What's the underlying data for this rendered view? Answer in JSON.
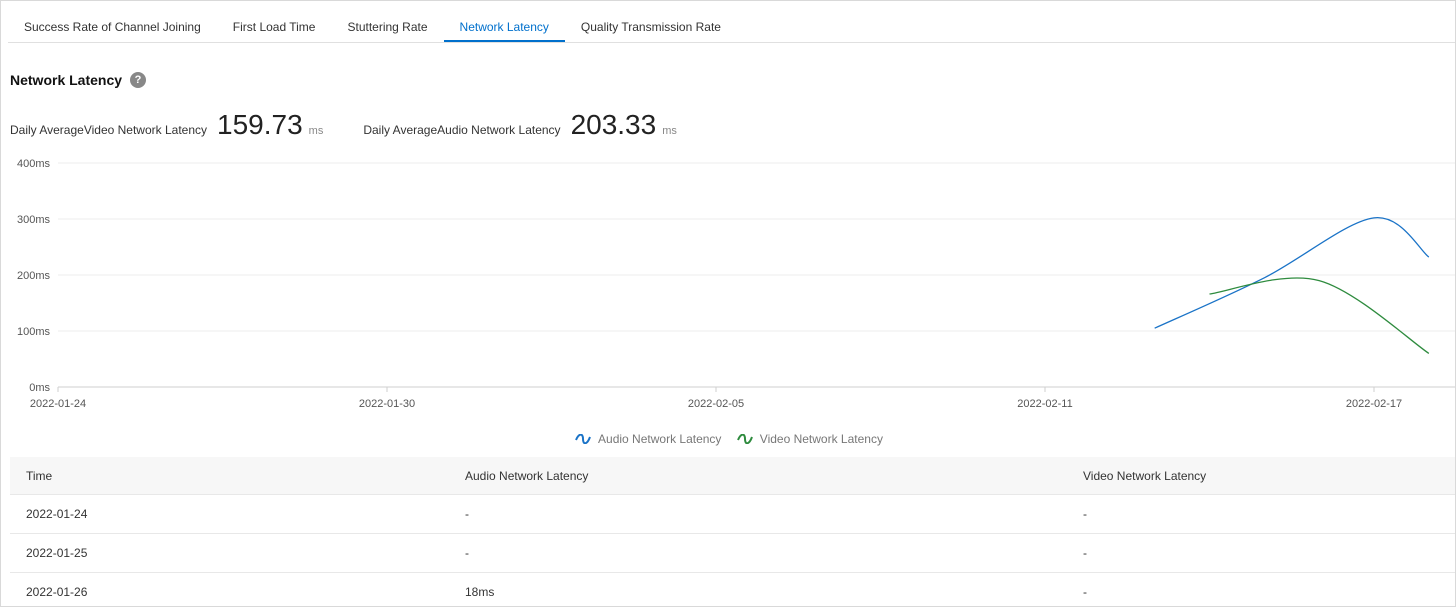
{
  "tabs": [
    {
      "label": "Success Rate of Channel Joining",
      "active": false
    },
    {
      "label": "First Load Time",
      "active": false
    },
    {
      "label": "Stuttering Rate",
      "active": false
    },
    {
      "label": "Network Latency",
      "active": true
    },
    {
      "label": "Quality Transmission Rate",
      "active": false
    }
  ],
  "section": {
    "title": "Network Latency",
    "help_icon": "question-circle-icon"
  },
  "kpis": [
    {
      "label": "Daily AverageVideo Network Latency",
      "value": "159.73",
      "unit": "ms"
    },
    {
      "label": "Daily AverageAudio Network Latency",
      "value": "203.33",
      "unit": "ms"
    }
  ],
  "chart_data": {
    "type": "line",
    "y_ticks": [
      "0ms",
      "100ms",
      "200ms",
      "300ms",
      "400ms"
    ],
    "ylim": [
      0,
      400
    ],
    "x_ticks": [
      "2022-01-24",
      "2022-01-30",
      "2022-02-05",
      "2022-02-11",
      "2022-02-17"
    ],
    "grid": true,
    "legend_position": "bottom-center",
    "series": [
      {
        "name": "Audio Network Latency",
        "color": "#1a73c7",
        "points": [
          [
            "2022-02-13",
            105
          ],
          [
            "2022-02-15",
            195
          ],
          [
            "2022-02-17",
            302
          ],
          [
            "2022-02-18",
            232
          ]
        ]
      },
      {
        "name": "Video Network Latency",
        "color": "#2e8b3e",
        "points": [
          [
            "2022-02-14",
            166
          ],
          [
            "2022-02-16",
            190
          ],
          [
            "2022-02-18",
            60
          ]
        ]
      }
    ]
  },
  "table": {
    "headers": [
      "Time",
      "Audio Network Latency",
      "Video Network Latency"
    ],
    "rows": [
      [
        "2022-01-24",
        "-",
        "-"
      ],
      [
        "2022-01-25",
        "-",
        "-"
      ],
      [
        "2022-01-26",
        "18ms",
        "-"
      ]
    ]
  }
}
